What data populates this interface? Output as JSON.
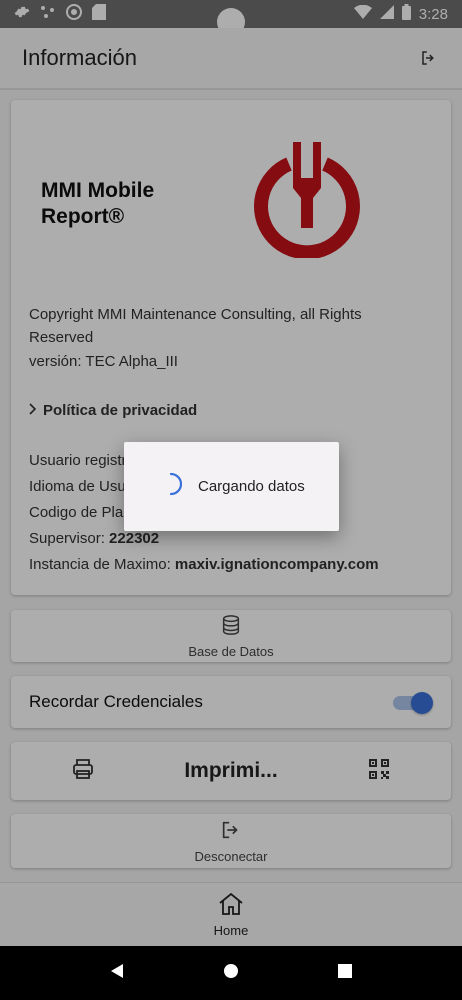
{
  "status_bar": {
    "time": "3:28"
  },
  "appbar": {
    "title": "Información"
  },
  "info": {
    "app_name": "MMI Mobile Report®",
    "copyright": "Copyright MMI Maintenance Consulting, all Rights Reserved",
    "version": "versión: TEC Alpha_III",
    "privacy_link": "Política de privacidad",
    "user_label": "Usuario registrado:",
    "user_value": "",
    "language_label": "Idioma de Usuario:",
    "language_value": "",
    "plant_label": "Codigo de Planta:",
    "plant_value": "",
    "supervisor_label": "Supervisor:",
    "supervisor_value": "222302",
    "instance_label": "Instancia de Maximo:",
    "instance_value": "maxiv.ignationcompany.com"
  },
  "database": {
    "label": "Base de Datos"
  },
  "remember": {
    "label": "Recordar Credenciales",
    "enabled": true
  },
  "print": {
    "label": "Imprimi..."
  },
  "disconnect": {
    "label": "Desconectar"
  },
  "bottom_nav": {
    "home_label": "Home"
  },
  "loading_dialog": {
    "text": "Cargando datos"
  },
  "colors": {
    "accent": "#3a71d9",
    "logo_red": "#c4131a",
    "scrim": "rgba(0,0,0,0.32)"
  },
  "icons": [
    "gear-icon",
    "dots-icon",
    "sync-icon",
    "sd-card-icon",
    "wifi-icon",
    "signal-icon",
    "battery-icon",
    "logout-icon",
    "database-icon",
    "printer-icon",
    "qr-code-icon",
    "home-icon",
    "back-icon",
    "home-circle-icon",
    "recents-icon",
    "spinner-icon",
    "chevron-right-icon"
  ]
}
